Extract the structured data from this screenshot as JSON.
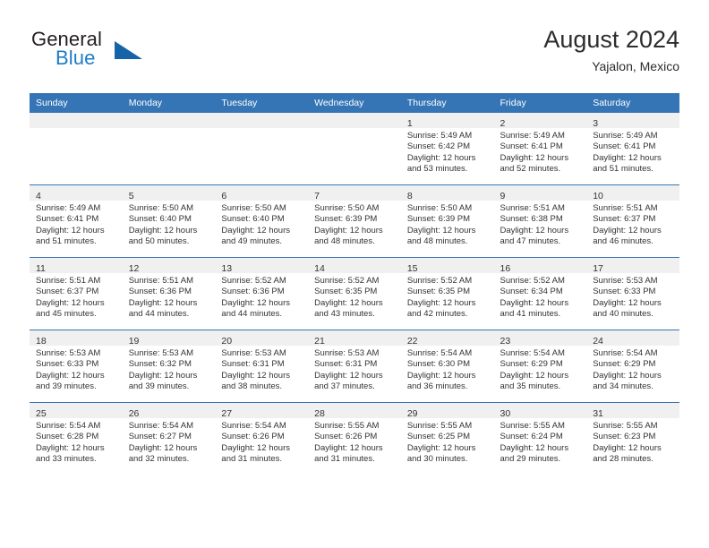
{
  "brand": {
    "name_part1": "General",
    "name_part2": "Blue",
    "logo_icon": "triangle-logo-icon"
  },
  "header": {
    "title": "August 2024",
    "subtitle": "Yajalon, Mexico"
  },
  "calendar": {
    "weekday_headers": [
      "Sunday",
      "Monday",
      "Tuesday",
      "Wednesday",
      "Thursday",
      "Friday",
      "Saturday"
    ],
    "accent_color": "#3575b5",
    "daynum_bg": "#f0f0f0",
    "weeks": [
      [
        {
          "day": "",
          "empty": true
        },
        {
          "day": "",
          "empty": true
        },
        {
          "day": "",
          "empty": true
        },
        {
          "day": "",
          "empty": true
        },
        {
          "day": "1",
          "sunrise": "Sunrise: 5:49 AM",
          "sunset": "Sunset: 6:42 PM",
          "daylight1": "Daylight: 12 hours",
          "daylight2": "and 53 minutes."
        },
        {
          "day": "2",
          "sunrise": "Sunrise: 5:49 AM",
          "sunset": "Sunset: 6:41 PM",
          "daylight1": "Daylight: 12 hours",
          "daylight2": "and 52 minutes."
        },
        {
          "day": "3",
          "sunrise": "Sunrise: 5:49 AM",
          "sunset": "Sunset: 6:41 PM",
          "daylight1": "Daylight: 12 hours",
          "daylight2": "and 51 minutes."
        }
      ],
      [
        {
          "day": "4",
          "sunrise": "Sunrise: 5:49 AM",
          "sunset": "Sunset: 6:41 PM",
          "daylight1": "Daylight: 12 hours",
          "daylight2": "and 51 minutes."
        },
        {
          "day": "5",
          "sunrise": "Sunrise: 5:50 AM",
          "sunset": "Sunset: 6:40 PM",
          "daylight1": "Daylight: 12 hours",
          "daylight2": "and 50 minutes."
        },
        {
          "day": "6",
          "sunrise": "Sunrise: 5:50 AM",
          "sunset": "Sunset: 6:40 PM",
          "daylight1": "Daylight: 12 hours",
          "daylight2": "and 49 minutes."
        },
        {
          "day": "7",
          "sunrise": "Sunrise: 5:50 AM",
          "sunset": "Sunset: 6:39 PM",
          "daylight1": "Daylight: 12 hours",
          "daylight2": "and 48 minutes."
        },
        {
          "day": "8",
          "sunrise": "Sunrise: 5:50 AM",
          "sunset": "Sunset: 6:39 PM",
          "daylight1": "Daylight: 12 hours",
          "daylight2": "and 48 minutes."
        },
        {
          "day": "9",
          "sunrise": "Sunrise: 5:51 AM",
          "sunset": "Sunset: 6:38 PM",
          "daylight1": "Daylight: 12 hours",
          "daylight2": "and 47 minutes."
        },
        {
          "day": "10",
          "sunrise": "Sunrise: 5:51 AM",
          "sunset": "Sunset: 6:37 PM",
          "daylight1": "Daylight: 12 hours",
          "daylight2": "and 46 minutes."
        }
      ],
      [
        {
          "day": "11",
          "sunrise": "Sunrise: 5:51 AM",
          "sunset": "Sunset: 6:37 PM",
          "daylight1": "Daylight: 12 hours",
          "daylight2": "and 45 minutes."
        },
        {
          "day": "12",
          "sunrise": "Sunrise: 5:51 AM",
          "sunset": "Sunset: 6:36 PM",
          "daylight1": "Daylight: 12 hours",
          "daylight2": "and 44 minutes."
        },
        {
          "day": "13",
          "sunrise": "Sunrise: 5:52 AM",
          "sunset": "Sunset: 6:36 PM",
          "daylight1": "Daylight: 12 hours",
          "daylight2": "and 44 minutes."
        },
        {
          "day": "14",
          "sunrise": "Sunrise: 5:52 AM",
          "sunset": "Sunset: 6:35 PM",
          "daylight1": "Daylight: 12 hours",
          "daylight2": "and 43 minutes."
        },
        {
          "day": "15",
          "sunrise": "Sunrise: 5:52 AM",
          "sunset": "Sunset: 6:35 PM",
          "daylight1": "Daylight: 12 hours",
          "daylight2": "and 42 minutes."
        },
        {
          "day": "16",
          "sunrise": "Sunrise: 5:52 AM",
          "sunset": "Sunset: 6:34 PM",
          "daylight1": "Daylight: 12 hours",
          "daylight2": "and 41 minutes."
        },
        {
          "day": "17",
          "sunrise": "Sunrise: 5:53 AM",
          "sunset": "Sunset: 6:33 PM",
          "daylight1": "Daylight: 12 hours",
          "daylight2": "and 40 minutes."
        }
      ],
      [
        {
          "day": "18",
          "sunrise": "Sunrise: 5:53 AM",
          "sunset": "Sunset: 6:33 PM",
          "daylight1": "Daylight: 12 hours",
          "daylight2": "and 39 minutes."
        },
        {
          "day": "19",
          "sunrise": "Sunrise: 5:53 AM",
          "sunset": "Sunset: 6:32 PM",
          "daylight1": "Daylight: 12 hours",
          "daylight2": "and 39 minutes."
        },
        {
          "day": "20",
          "sunrise": "Sunrise: 5:53 AM",
          "sunset": "Sunset: 6:31 PM",
          "daylight1": "Daylight: 12 hours",
          "daylight2": "and 38 minutes."
        },
        {
          "day": "21",
          "sunrise": "Sunrise: 5:53 AM",
          "sunset": "Sunset: 6:31 PM",
          "daylight1": "Daylight: 12 hours",
          "daylight2": "and 37 minutes."
        },
        {
          "day": "22",
          "sunrise": "Sunrise: 5:54 AM",
          "sunset": "Sunset: 6:30 PM",
          "daylight1": "Daylight: 12 hours",
          "daylight2": "and 36 minutes."
        },
        {
          "day": "23",
          "sunrise": "Sunrise: 5:54 AM",
          "sunset": "Sunset: 6:29 PM",
          "daylight1": "Daylight: 12 hours",
          "daylight2": "and 35 minutes."
        },
        {
          "day": "24",
          "sunrise": "Sunrise: 5:54 AM",
          "sunset": "Sunset: 6:29 PM",
          "daylight1": "Daylight: 12 hours",
          "daylight2": "and 34 minutes."
        }
      ],
      [
        {
          "day": "25",
          "sunrise": "Sunrise: 5:54 AM",
          "sunset": "Sunset: 6:28 PM",
          "daylight1": "Daylight: 12 hours",
          "daylight2": "and 33 minutes."
        },
        {
          "day": "26",
          "sunrise": "Sunrise: 5:54 AM",
          "sunset": "Sunset: 6:27 PM",
          "daylight1": "Daylight: 12 hours",
          "daylight2": "and 32 minutes."
        },
        {
          "day": "27",
          "sunrise": "Sunrise: 5:54 AM",
          "sunset": "Sunset: 6:26 PM",
          "daylight1": "Daylight: 12 hours",
          "daylight2": "and 31 minutes."
        },
        {
          "day": "28",
          "sunrise": "Sunrise: 5:55 AM",
          "sunset": "Sunset: 6:26 PM",
          "daylight1": "Daylight: 12 hours",
          "daylight2": "and 31 minutes."
        },
        {
          "day": "29",
          "sunrise": "Sunrise: 5:55 AM",
          "sunset": "Sunset: 6:25 PM",
          "daylight1": "Daylight: 12 hours",
          "daylight2": "and 30 minutes."
        },
        {
          "day": "30",
          "sunrise": "Sunrise: 5:55 AM",
          "sunset": "Sunset: 6:24 PM",
          "daylight1": "Daylight: 12 hours",
          "daylight2": "and 29 minutes."
        },
        {
          "day": "31",
          "sunrise": "Sunrise: 5:55 AM",
          "sunset": "Sunset: 6:23 PM",
          "daylight1": "Daylight: 12 hours",
          "daylight2": "and 28 minutes."
        }
      ]
    ]
  }
}
